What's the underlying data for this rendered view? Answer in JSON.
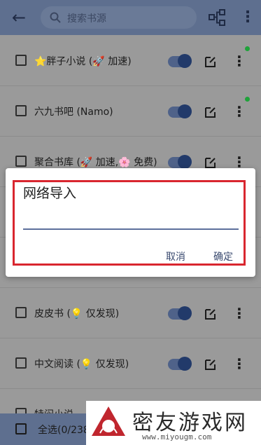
{
  "topbar": {
    "search_placeholder": "搜索书源",
    "icons": [
      "back-arrow-icon",
      "search-icon",
      "tree-icon",
      "more-vert-icon"
    ]
  },
  "rows": [
    {
      "name": "⭐胖子小说 (🚀 加速)",
      "enabled": true,
      "update_dot": true
    },
    {
      "name": "六九书吧 (Namo)",
      "enabled": true,
      "update_dot": true
    },
    {
      "name": "聚合书库 (🚀 加速,🌸 免费)",
      "enabled": true,
      "update_dot": false
    },
    {
      "name": "",
      "enabled": true,
      "update_dot": false
    },
    {
      "name": "",
      "enabled": true,
      "update_dot": false
    },
    {
      "name": "皮皮书 (💡 仅发现)",
      "enabled": true,
      "update_dot": false
    },
    {
      "name": "中文阅读 (💡 仅发现)",
      "enabled": true,
      "update_dot": false
    },
    {
      "name": "特闷小说",
      "enabled": true,
      "update_dot": false
    }
  ],
  "bottombar": {
    "select_all_label": "全选(0/238)"
  },
  "dialog": {
    "title": "网络导入",
    "input_value": "",
    "cancel_label": "取消",
    "ok_label": "确定"
  },
  "watermark": {
    "text": "密友游戏网",
    "url": "www.miyougm.com"
  },
  "colors": {
    "accent": "#3a4a6f",
    "highlight_border": "#d9262f",
    "update_dot": "#1fa33a"
  }
}
